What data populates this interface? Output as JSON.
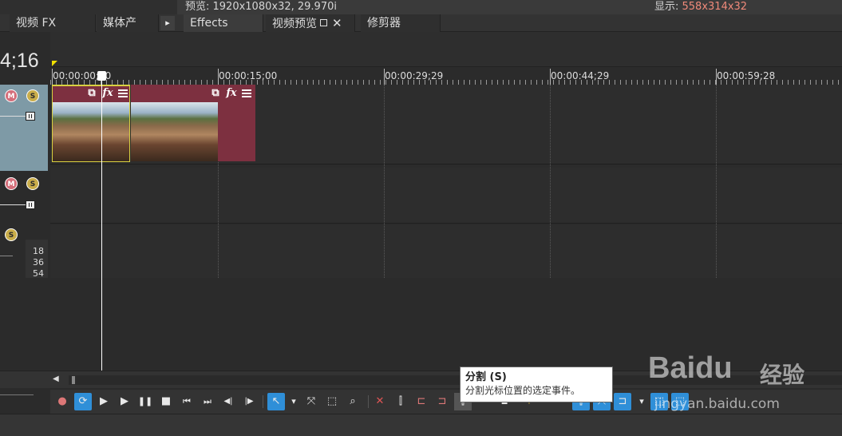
{
  "header": {
    "preview_label": "预览: 1920x1080x32, 29.970i",
    "display_prefix": "显示: ",
    "display_value": "558x314x32"
  },
  "tabs": {
    "video_fx": "视频 FX",
    "media_gen": "媒体产",
    "arrow": "▸",
    "effects": "Effects",
    "video_preview": "视频预览",
    "close": "✕",
    "trimmer": "修剪器"
  },
  "timecode": "4;16",
  "ruler": {
    "labels": [
      "00:00:00;00",
      "00:00:15;00",
      "00:00:29;29",
      "00:00:44;29",
      "00:00:59;28"
    ]
  },
  "tracks": {
    "mute_glyph": "M",
    "solo_glyph": "S",
    "level_values": [
      "18",
      "36",
      "54"
    ]
  },
  "clips": {
    "icon_crop": "⧉",
    "icon_fx": "fx"
  },
  "toolbar": {
    "record": "●",
    "loop": "⟳",
    "play_from_start": "▶",
    "play": "▶",
    "pause": "❚❚",
    "stop": "■",
    "prev": "⏮",
    "next": "⏭",
    "prev_frame": "◀|",
    "next_frame": "|▶",
    "normal_edit": "↖",
    "dropdown": "▾",
    "envelope": "⤧",
    "selection": "⬚",
    "zoom": "⌕",
    "delete": "✕",
    "trim_start": "⊏",
    "trim_end": "⊐",
    "split": "⫿",
    "lock": "■",
    "marker": "⚑"
  },
  "tooltip": {
    "title": "分割 (S)",
    "description": "分割光标位置的选定事件。"
  },
  "watermark": {
    "logo": "Baidu",
    "jingyan": "经验",
    "url": "jingyan.baidu.com"
  },
  "colors": {
    "clip": "#7d3040",
    "track_header": "#7e9aa6",
    "accent": "#2f8fd8",
    "display_value": "#f08a7a"
  }
}
